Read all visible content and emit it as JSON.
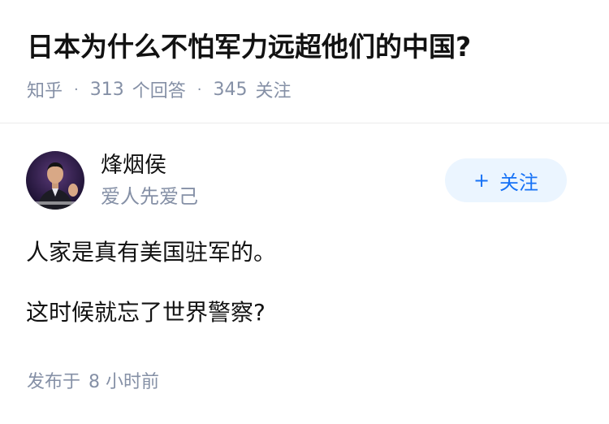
{
  "question": {
    "title": "日本为什么不怕军力远超他们的中国?",
    "source": "知乎",
    "answer_count": "313",
    "answer_count_label": "个回答",
    "follower_count": "345",
    "follower_count_label": "关注"
  },
  "answer": {
    "author": {
      "name": "烽烟侯",
      "bio": "爱人先爱己",
      "avatar_icon": "person-avatar-icon"
    },
    "follow_button": {
      "icon": "plus-icon",
      "plus_glyph": "+",
      "label": "关注"
    },
    "paragraphs": [
      "人家是真有美国驻军的。",
      "这时候就忘了世界警察?"
    ],
    "footer": {
      "published_label": "发布于",
      "time": "8 小时前"
    }
  },
  "colors": {
    "text_primary": "#121212",
    "text_secondary": "#8590a6",
    "accent": "#1772f6",
    "follow_bg": "#ebf5ff"
  }
}
